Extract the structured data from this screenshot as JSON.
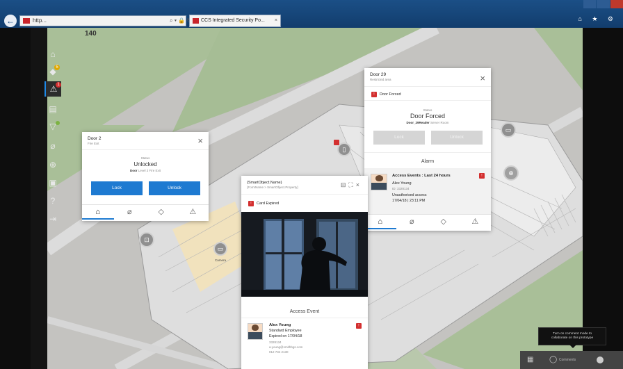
{
  "browser": {
    "address": "http...",
    "address_controls": "⌕ ▾ 🔒 ↻",
    "tab_title": "CCS Integrated Security Po...",
    "tab_close": "×",
    "icons": "⌂ ★ ⚙",
    "colors": {
      "chrome": "#1b4f86",
      "brand": "#c8242b"
    }
  },
  "sidebar": {
    "items": [
      {
        "icon": "home-icon",
        "glyph": "⌂"
      },
      {
        "icon": "diamond-icon",
        "glyph": "◆",
        "badge": "5"
      },
      {
        "icon": "alarm-triangle-icon",
        "glyph": "⚠",
        "badge": "1",
        "active": true
      },
      {
        "icon": "building-icon",
        "glyph": "▤"
      },
      {
        "icon": "filter-icon",
        "glyph": "▽"
      },
      {
        "icon": "tag-icon",
        "glyph": "⌀"
      },
      {
        "icon": "lock-icon",
        "glyph": "⊕"
      },
      {
        "icon": "id-card-icon",
        "glyph": "▣"
      },
      {
        "icon": "help-icon",
        "glyph": "?"
      },
      {
        "icon": "logout-icon",
        "glyph": "⇥"
      }
    ]
  },
  "map": {
    "label": "140"
  },
  "door2": {
    "title": "Door 2",
    "subtitle": "Fire Exit",
    "close": "×",
    "status_label": "Status",
    "status": "Unlocked",
    "location_strong": "Door",
    "location": "Level 2 Fire Exit",
    "lock_label": "Lock",
    "unlock_label": "Unlock"
  },
  "door29": {
    "title": "Door 29",
    "subtitle": "Restricted area",
    "close": "×",
    "alert_icon": "!",
    "alert": "Door Forced",
    "status_label": "Status",
    "status": "Door Forced",
    "location_strong": "Door_29Reader",
    "location": "Server Room",
    "lock_label": "Lock",
    "unlock_label": "Unlock",
    "section": "Alarm",
    "event": {
      "heading": "Access Events : Last 24 hours",
      "name": "Alex Young",
      "id": "ID: 3328134",
      "description": "Unauthorised access",
      "time": "17/04/18 | 23:11 PM"
    }
  },
  "smartobject": {
    "title": "{SmartObject.Name}",
    "subtitle": "{FormName > SmartObject.Property}",
    "alert_icon": "!",
    "alert": "Card Expired",
    "section": "Access Event",
    "person": {
      "name": "Alex Young",
      "role": "Standard Employee",
      "expired": "Expired on 17/04/18",
      "id": "3328134",
      "email": "a.young@smithbgs.com",
      "phone": "012 734 2130"
    }
  },
  "markers": {
    "camera_label": "Camera"
  },
  "comment_tip": {
    "line1": "Turn on comment mode to",
    "line2": "collaborate on this prototype"
  },
  "bottom_bar": {
    "comments_label": "Comments"
  }
}
